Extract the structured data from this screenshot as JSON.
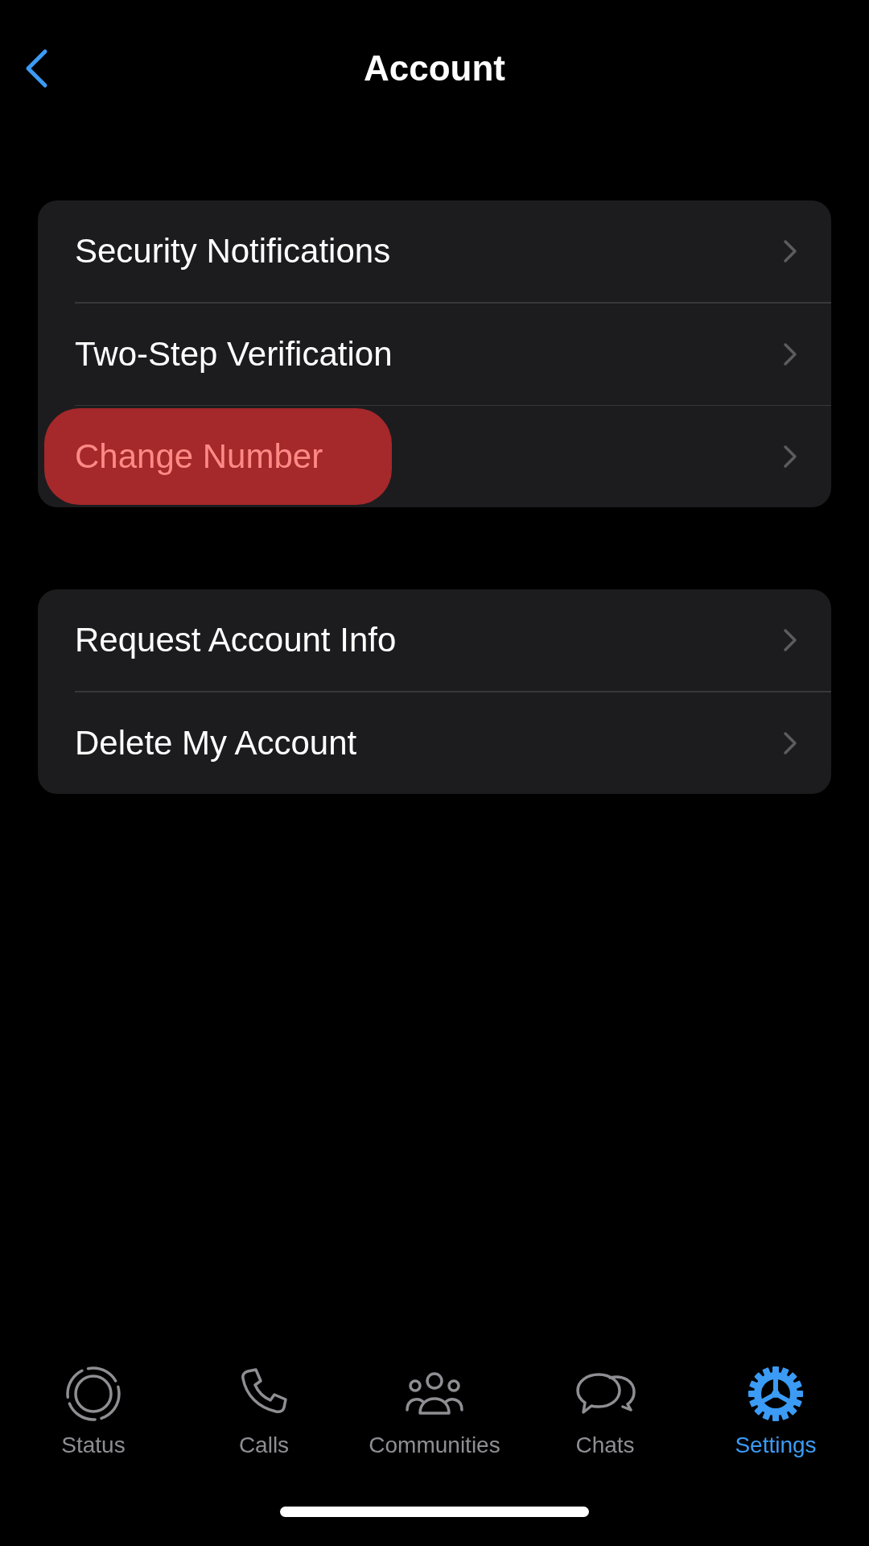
{
  "header": {
    "title": "Account"
  },
  "groups": [
    {
      "items": [
        {
          "label": "Security Notifications",
          "highlighted": false
        },
        {
          "label": "Two-Step Verification",
          "highlighted": false
        },
        {
          "label": "Change Number",
          "highlighted": true
        }
      ]
    },
    {
      "items": [
        {
          "label": "Request Account Info",
          "highlighted": false
        },
        {
          "label": "Delete My Account",
          "highlighted": false
        }
      ]
    }
  ],
  "tabs": [
    {
      "kind": "status",
      "label": "Status",
      "selected": false
    },
    {
      "kind": "calls",
      "label": "Calls",
      "selected": false
    },
    {
      "kind": "communities",
      "label": "Communities",
      "selected": false
    },
    {
      "kind": "chats",
      "label": "Chats",
      "selected": false
    },
    {
      "kind": "settings",
      "label": "Settings",
      "selected": true
    }
  ]
}
